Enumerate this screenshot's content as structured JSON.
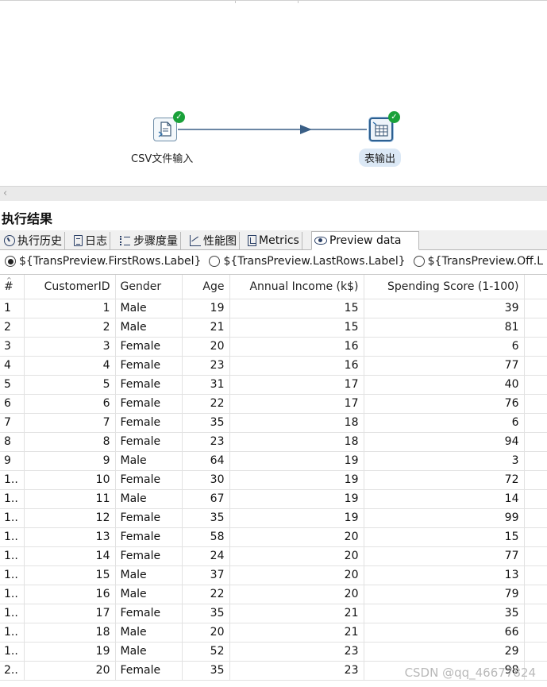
{
  "canvas": {
    "steps": [
      {
        "name": "csv-input-step",
        "label": "CSV文件输入",
        "icon": "csv-file-icon",
        "status": "success"
      },
      {
        "name": "table-output-step",
        "label": "表输出",
        "icon": "table-output-icon",
        "status": "success"
      }
    ],
    "status_color": "#1aa13a",
    "hop_color": "#3a5f86"
  },
  "results": {
    "title": "执行结果",
    "tabs": [
      {
        "label": "执行历史",
        "icon": "clock-icon"
      },
      {
        "label": "日志",
        "icon": "log-icon"
      },
      {
        "label": "步骤度量",
        "icon": "step-metrics-icon"
      },
      {
        "label": "性能图",
        "icon": "performance-chart-icon"
      },
      {
        "label": "Metrics",
        "icon": "metrics-icon"
      },
      {
        "label": "Preview data",
        "icon": "eye-icon",
        "active": true
      }
    ],
    "radio_options": [
      {
        "label": "${TransPreview.FirstRows.Label}",
        "checked": true
      },
      {
        "label": "${TransPreview.LastRows.Label}",
        "checked": false
      },
      {
        "label": "${TransPreview.Off.L",
        "checked": false
      }
    ]
  },
  "grid": {
    "columns": [
      "#",
      "CustomerID",
      "Gender",
      "Age",
      "Annual Income (k$)",
      "Spending Score (1-100)"
    ],
    "rows": [
      [
        "1",
        "1",
        "Male",
        "19",
        "15",
        "39"
      ],
      [
        "2",
        "2",
        "Male",
        "21",
        "15",
        "81"
      ],
      [
        "3",
        "3",
        "Female",
        "20",
        "16",
        "6"
      ],
      [
        "4",
        "4",
        "Female",
        "23",
        "16",
        "77"
      ],
      [
        "5",
        "5",
        "Female",
        "31",
        "17",
        "40"
      ],
      [
        "6",
        "6",
        "Female",
        "22",
        "17",
        "76"
      ],
      [
        "7",
        "7",
        "Female",
        "35",
        "18",
        "6"
      ],
      [
        "8",
        "8",
        "Female",
        "23",
        "18",
        "94"
      ],
      [
        "9",
        "9",
        "Male",
        "64",
        "19",
        "3"
      ],
      [
        "1..",
        "10",
        "Female",
        "30",
        "19",
        "72"
      ],
      [
        "1..",
        "11",
        "Male",
        "67",
        "19",
        "14"
      ],
      [
        "1..",
        "12",
        "Female",
        "35",
        "19",
        "99"
      ],
      [
        "1..",
        "13",
        "Female",
        "58",
        "20",
        "15"
      ],
      [
        "1..",
        "14",
        "Female",
        "24",
        "20",
        "77"
      ],
      [
        "1..",
        "15",
        "Male",
        "37",
        "20",
        "13"
      ],
      [
        "1..",
        "16",
        "Male",
        "22",
        "20",
        "79"
      ],
      [
        "1..",
        "17",
        "Female",
        "35",
        "21",
        "35"
      ],
      [
        "1..",
        "18",
        "Male",
        "20",
        "21",
        "66"
      ],
      [
        "1..",
        "19",
        "Male",
        "52",
        "23",
        "29"
      ],
      [
        "2..",
        "20",
        "Female",
        "35",
        "23",
        "98"
      ]
    ]
  },
  "watermark": "CSDN @qq_46677824"
}
